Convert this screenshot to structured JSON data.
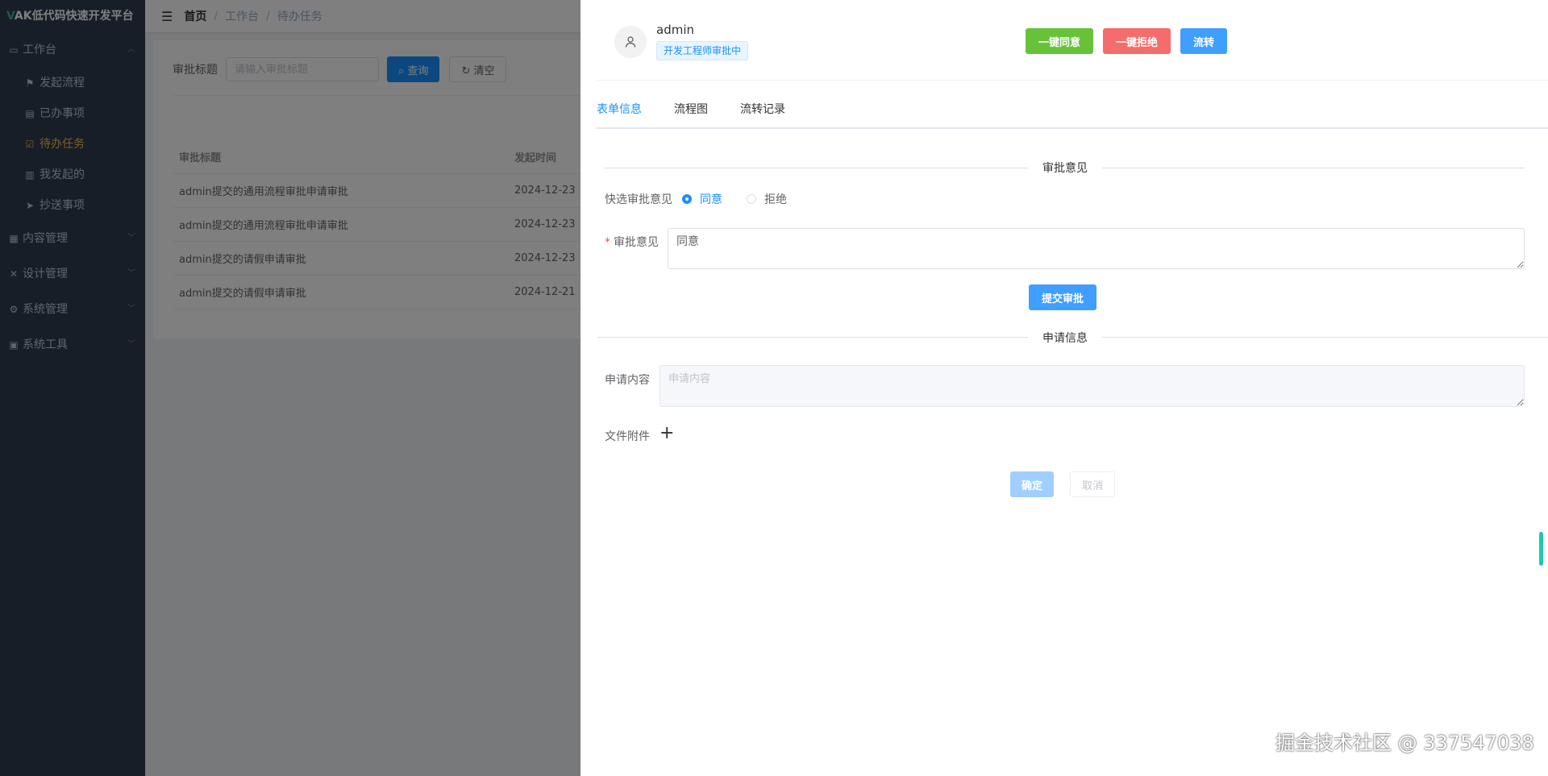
{
  "app": {
    "logo_v": "V",
    "logo_text": "AK低代码快速开发平台"
  },
  "sidebar": {
    "workbench": "工作台",
    "items": [
      {
        "label": "发起流程",
        "icon": "flag-icon"
      },
      {
        "label": "已办事项",
        "icon": "document-icon"
      },
      {
        "label": "待办任务",
        "icon": "checklist-icon"
      },
      {
        "label": "我发起的",
        "icon": "mine-icon"
      },
      {
        "label": "抄送事项",
        "icon": "send-icon"
      }
    ],
    "groups": [
      "内容管理",
      "设计管理",
      "系统管理",
      "系统工具"
    ]
  },
  "breadcrumb": [
    "首页",
    "工作台",
    "待办任务"
  ],
  "search": {
    "label": "审批标题",
    "placeholder": "请输入审批标题",
    "query_label": "查询",
    "clear_label": "清空"
  },
  "table": {
    "headers": [
      "审批标题",
      "发起时间"
    ],
    "rows": [
      [
        "admin提交的通用流程审批申请审批",
        "2024-12-23"
      ],
      [
        "admin提交的通用流程审批申请审批",
        "2024-12-23"
      ],
      [
        "admin提交的请假申请审批",
        "2024-12-23"
      ],
      [
        "admin提交的请假申请审批",
        "2024-12-21"
      ]
    ]
  },
  "drawer": {
    "username": "admin",
    "status_tag": "开发工程师审批中",
    "actions": {
      "approve_all": "一键同意",
      "reject_all": "一键拒绝",
      "transfer": "流转"
    },
    "tabs": [
      "表单信息",
      "流程图",
      "流转记录"
    ],
    "approval_section": "审批意见",
    "quick_label": "快选审批意见",
    "radio_agree": "同意",
    "radio_reject": "拒绝",
    "opinion_label": "审批意见",
    "opinion_value": "同意",
    "submit_label": "提交审批",
    "apply_section": "申请信息",
    "content_label": "申请内容",
    "content_placeholder": "申请内容",
    "attach_label": "文件附件",
    "ok_label": "确定",
    "cancel_label": "取消"
  },
  "watermark": "掘金技术社区 @ 337547038",
  "colors": {
    "primary": "#1890ff",
    "success": "#67c23a",
    "danger": "#f56c6c",
    "sidebar_bg": "#2f3d4e",
    "active_menu": "#f4c049"
  }
}
